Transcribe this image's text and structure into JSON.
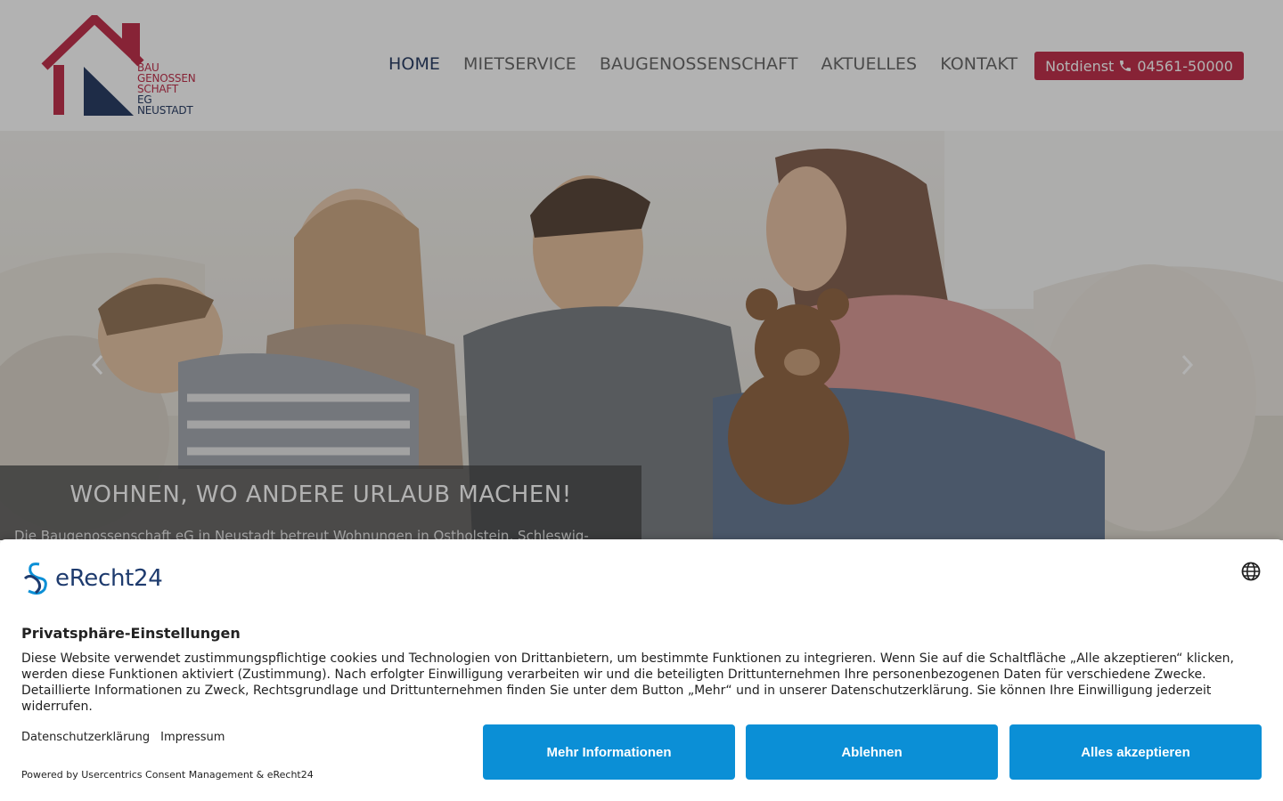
{
  "header": {
    "logo_lines": [
      "BAU",
      "GENOSSEN",
      "SCHAFT",
      "EG",
      "NEUSTADT"
    ],
    "nav": [
      {
        "label": "HOME",
        "active": true
      },
      {
        "label": "MIETSERVICE",
        "active": false
      },
      {
        "label": "BAUGENOSSENSCHAFT",
        "active": false
      },
      {
        "label": "AKTUELLES",
        "active": false
      },
      {
        "label": "KONTAKT",
        "active": false
      }
    ],
    "emergency": {
      "label": "Notdienst",
      "phone": "04561-50000",
      "icon": "phone-icon"
    }
  },
  "hero": {
    "caption_title": "WOHNEN, WO ANDERE URLAUB MACHEN!",
    "caption_text": "Die Baugenossenschaft eG in Neustadt betreut Wohnungen in Ostholstein, Schleswig-",
    "prev_icon": "chevron-left-icon",
    "next_icon": "chevron-right-icon"
  },
  "consent": {
    "brand": "eRecht24",
    "title": "Privatsphäre-Einstellungen",
    "text": "Diese Website verwendet zustimmungspflichtige cookies und Technologien von Drittanbietern, um bestimmte Funktionen zu integrieren. Wenn Sie auf die Schaltfläche „Alle akzeptieren“ klicken, werden diese Funktionen aktiviert (Zustimmung). Nach erfolgter Einwilligung verarbeiten wir und die beteiligten Drittunternehmen Ihre personenbezogenen Daten für verschiedene Zwecke. Detaillierte Informationen zu Zweck, Rechtsgrundlage und Drittunternehmen finden Sie unter dem Button „Mehr“ und in unserer Datenschutzerklärung. Sie können Ihre Einwilligung jederzeit widerrufen.",
    "link_privacy": "Datenschutzerklärung",
    "link_imprint": "Impressum",
    "powered": "Powered by Usercentrics Consent Management & eRecht24",
    "btn_more": "Mehr Informationen",
    "btn_decline": "Ablehnen",
    "btn_accept": "Alles akzeptieren",
    "language_icon": "globe-icon"
  },
  "colors": {
    "brand_red": "#c2334e",
    "brand_navy": "#2b3f66",
    "button_blue": "#0b8fd6"
  }
}
